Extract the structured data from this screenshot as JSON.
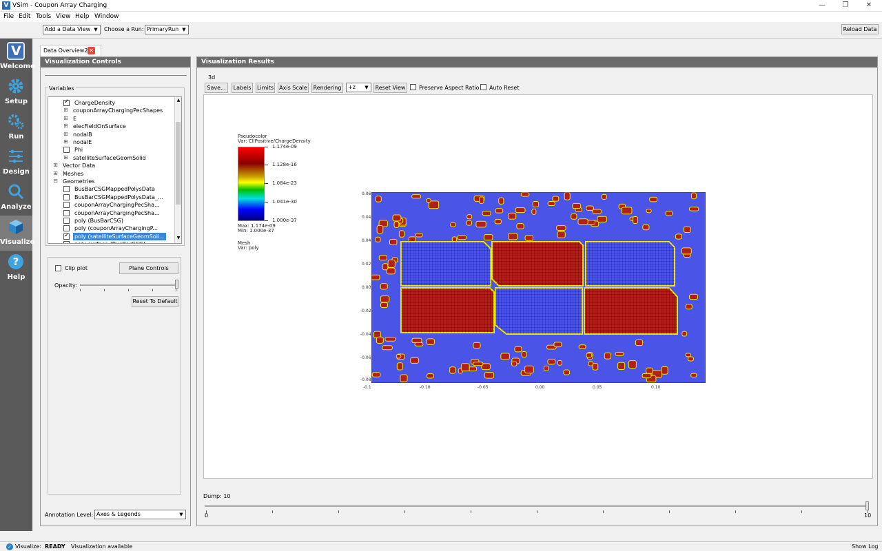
{
  "window": {
    "title": "VSim - Coupon Array Charging",
    "minimize": "—",
    "maximize": "❐",
    "close": "✕"
  },
  "menu": [
    "File",
    "Edit",
    "Tools",
    "View",
    "Help",
    "Window"
  ],
  "toolbar": {
    "add_view_label": "Add a Data View",
    "choose_run_label": "Choose a Run:",
    "run_value": "PrimaryRun",
    "reload_label": "Reload Data"
  },
  "sidebar": [
    {
      "label": "Welcome",
      "icon": "vsim-logo-icon"
    },
    {
      "label": "Setup",
      "icon": "gear-icon"
    },
    {
      "label": "Run",
      "icon": "gears-icon"
    },
    {
      "label": "Design",
      "icon": "design-icon"
    },
    {
      "label": "Analyze",
      "icon": "magnifier-icon"
    },
    {
      "label": "Visualize",
      "icon": "cube-icon"
    },
    {
      "label": "Help",
      "icon": "question-icon"
    }
  ],
  "tab": {
    "label": "Data Overview2"
  },
  "controls": {
    "header": "Visualization Controls",
    "variables_label": "Variables",
    "tree": [
      {
        "label": "ChargeDensity",
        "indent": 2,
        "type": "check",
        "checked": true
      },
      {
        "label": "couponArrayChargingPecShapes",
        "indent": 1,
        "type": "expand"
      },
      {
        "label": "E",
        "indent": 1,
        "type": "expand"
      },
      {
        "label": "elecFieldOnSurface",
        "indent": 1,
        "type": "expand"
      },
      {
        "label": "nodalB",
        "indent": 1,
        "type": "expand"
      },
      {
        "label": "nodalE",
        "indent": 1,
        "type": "expand"
      },
      {
        "label": "Phi",
        "indent": 2,
        "type": "check",
        "checked": false
      },
      {
        "label": "satelliteSurfaceGeomSolid",
        "indent": 1,
        "type": "expand"
      },
      {
        "label": "Vector Data",
        "indent": 0,
        "type": "expand"
      },
      {
        "label": "Meshes",
        "indent": 0,
        "type": "expand"
      },
      {
        "label": "Geometries",
        "indent": 0,
        "type": "collapse"
      },
      {
        "label": "BusBarCSGMappedPolysData",
        "indent": 2,
        "type": "check",
        "checked": false
      },
      {
        "label": "BusBarCSGMappedPolysData_...",
        "indent": 2,
        "type": "check",
        "checked": false
      },
      {
        "label": "couponArrayChargingPecSha...",
        "indent": 2,
        "type": "check",
        "checked": false
      },
      {
        "label": "couponArrayChargingPecSha...",
        "indent": 2,
        "type": "check",
        "checked": false
      },
      {
        "label": "poly (BusBarCSG)",
        "indent": 2,
        "type": "check",
        "checked": false
      },
      {
        "label": "poly (couponArrayChargingP...",
        "indent": 2,
        "type": "check",
        "checked": false
      },
      {
        "label": "poly (satelliteSurfaceGeomSoli...",
        "indent": 2,
        "type": "check",
        "checked": true,
        "selected": true
      },
      {
        "label": "poly surface (BusBarCSG)",
        "indent": 2,
        "type": "check",
        "checked": false
      }
    ],
    "clip_plot_label": "Clip plot",
    "plane_controls_label": "Plane Controls",
    "opacity_label": "Opacity:",
    "reset_default_label": "Reset To Default",
    "annotation_label": "Annotation Level:",
    "annotation_value": "Axes & Legends"
  },
  "results": {
    "header": "Visualization Results",
    "view_label": "3d",
    "buttons": {
      "save": "Save...",
      "labels": "Labels",
      "limits": "Limits",
      "axis_scale": "Axis Scale",
      "rendering": "Rendering",
      "reset_view": "Reset View"
    },
    "axis_value": "+z",
    "preserve_label": "Preserve Aspect Ratio",
    "auto_reset_label": "Auto Reset",
    "legend": {
      "title": "Pseudocolor",
      "var": "Var: CllPositive/ChargeDensity",
      "ticks": [
        "1.174e-09",
        "1.128e-16",
        "1.084e-23",
        "1.041e-30",
        "1.000e-37"
      ],
      "max": "Max:  1.174e-09",
      "min": "Min:  1.000e-37",
      "mesh_title": "Mesh",
      "mesh_var": "Var: poly"
    },
    "y_ticks": [
      "0.06",
      "0.04",
      "0.04",
      "0.02",
      "0.00",
      "-0.02",
      "-0.04",
      "-0.06",
      "-0.08"
    ],
    "x_ticks": [
      "-0.10",
      "-0.05",
      "0.00",
      "0.05",
      "0.10"
    ],
    "x_corner": "-0.1",
    "dump_label": "Dump: 10",
    "slider_min": "0",
    "slider_max": "10",
    "dump_value": 10,
    "dump_max": 10
  },
  "status": {
    "prefix": "Visualize:",
    "state": "READY",
    "message": "Visualization available",
    "show_log": "Show Log"
  },
  "colors": {
    "field_blue": "#4a55e8",
    "field_red": "#b0201a",
    "sidebar_bg": "#5a5a5a",
    "selection": "#3a86d8"
  }
}
